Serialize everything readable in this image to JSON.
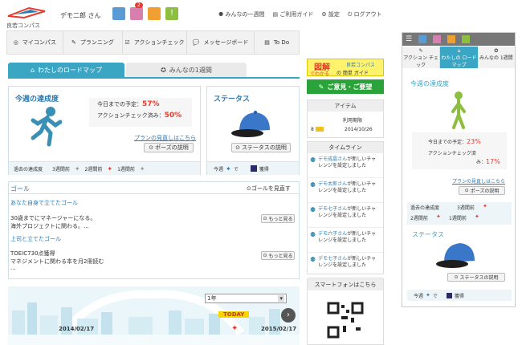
{
  "header": {
    "brand": "良若コンパス",
    "user": "デモ二郎 さん",
    "notif_count": "2",
    "link_roadmap": "みんなの一週間",
    "link_guide": "ご利用ガイド",
    "link_settings": "設定",
    "link_logout": "ログアウト"
  },
  "nav": {
    "items": [
      "マイコンパス",
      "プランニング",
      "アクションチェック",
      "メッセージボード",
      "To Do"
    ]
  },
  "tabs": {
    "my_roadmap": "わたしのロードマップ",
    "week": "みんなの1週間"
  },
  "achieve": {
    "title": "今週の達成度",
    "plan_label": "今日までの予定：",
    "plan_value": "57%",
    "check_label": "アクションチェック済み：",
    "check_value": "50%",
    "review_link": "プランの見直しはこちら",
    "pose_button": "ポーズの説明",
    "past_label": "過去の達成度",
    "w3": "3週間前",
    "w2": "2週間前",
    "w1": "1週間前"
  },
  "status": {
    "title": "ステータス",
    "button": "ステータスの説明",
    "now_label": "今週",
    "now_suffix": "で",
    "acquired": "獲得"
  },
  "goal": {
    "title": "ゴール",
    "review_button": "ゴールを見直す",
    "self_title": "あなた自身で立てたゴール",
    "self_line1": "30歳までにマネージャーになる。",
    "self_line2": "海外プロジェクトに関わる。...",
    "more": "もっと見る",
    "boss_title": "上司と立てたゴール",
    "boss_line1": "TOEIC730点獲得",
    "boss_line2": "マネジメントに関わる本を月2冊読む",
    "boss_line3": "..."
  },
  "timeline_chart": {
    "period": "1年",
    "today": "TODAY",
    "date_start": "2014/02/17",
    "date_end": "2015/02/17"
  },
  "side": {
    "banner_main": "図解",
    "banner_sub": "でわかる",
    "banner_brand": "良若コンパス",
    "banner_guide": "の 簡単 ガイド",
    "feedback": "ご意見・ご要望",
    "item_header": "アイテム",
    "item_col": "利用期限",
    "item_count": "8",
    "item_date": "2014/10/26",
    "timeline_header": "タイムライン",
    "timeline": [
      {
        "name": "デモ成晶さん",
        "text": "が新しいチャレンジを設定しました"
      },
      {
        "name": "デモ太郎さん",
        "text": "が新しいチャレンジを設定しました"
      },
      {
        "name": "デモ七子さん",
        "text": "が新しいチャレンジを設定しました"
      },
      {
        "name": "デモ六子さん",
        "text": "が新しいチャレンジを設定しました"
      },
      {
        "name": "デモ七子さん",
        "text": "が新しいチャレンジを設定しました"
      }
    ],
    "smartphone": "スマートフォンはこちら"
  },
  "mobile": {
    "tabs": [
      "アクション チェック",
      "わたしの ロードマップ",
      "みんなの 1週間"
    ],
    "achieve_title": "今週の達成度",
    "plan_label": "今日までの予定：",
    "plan_value": "23%",
    "check_label": "アクションチェック済",
    "check_label2": "み：",
    "check_value": "17%",
    "review_link": "プランの見直しはこちら",
    "pose_button": "ポーズの説明",
    "past_label": "過去の達成度",
    "w3": "3週間前",
    "w2": "2週間前",
    "w1": "1週間前",
    "status_title": "ステータス",
    "status_button": "ステータスの説明",
    "now_label": "今週",
    "now_suffix": "で",
    "acquired": "獲得"
  },
  "colors": {
    "teal": "#3aa6c4",
    "red": "#e63a2e",
    "green": "#2aa43a",
    "cap_blue": "#3a77c8",
    "runner_green": "#8cbf3f"
  }
}
